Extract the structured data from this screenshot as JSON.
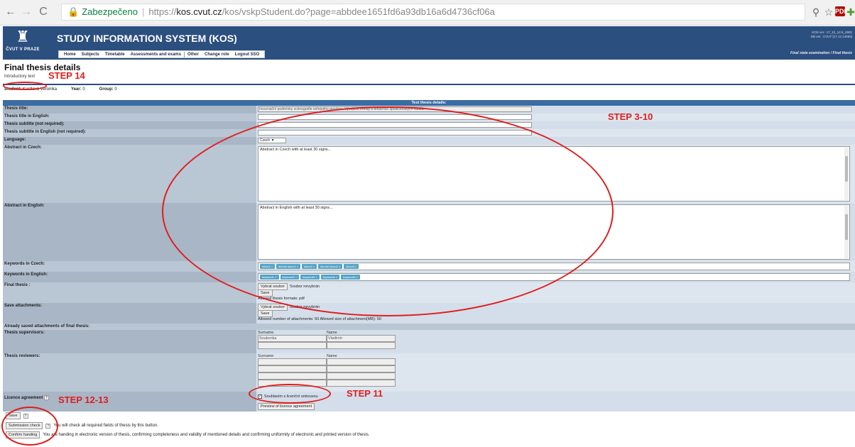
{
  "browser": {
    "secure_label": "Zabezpečeno",
    "url_protocol": "https://",
    "url_host": "kos.cvut.cz",
    "url_path": "/kos/vskpStudent.do?page=abbdee1651fd6a93db16a6d4736cf06a",
    "pdf_icon": "PDF"
  },
  "header": {
    "logo_text": "ČVUT V PRAZE",
    "app_title": "STUDY INFORMATION SYSTEM (KOS)",
    "menu": [
      "Home",
      "Subjects",
      "Timetable",
      "Assessments and exams",
      "Other",
      "Change role",
      "Logout SSO"
    ],
    "version_line1": "KOS ver.: 17_12_12.5_2602",
    "version_line2": "DB ver.: CVUT [17.12.14555]",
    "breadcrumb": "Final state examination / Final thesis"
  },
  "page": {
    "title": "Final thesis details",
    "intro": "Introductory text"
  },
  "student": {
    "label": "Student:",
    "name": "Kastlová Veronika",
    "year_label": "Year:",
    "year": "0",
    "group_label": "Group:",
    "group": "0"
  },
  "form": {
    "header": "Test thesis details:",
    "thesis_title_label": "Thesis title:",
    "thesis_title_value": "Inscenační podmínky scénografie veřejného prostoru. Vývojové trendy a tendence společenských rituálů.",
    "title_en_label": "Thesis title in English:",
    "subtitle_label": "Thesis subtitle (not required):",
    "subtitle_en_label": "Thesis subtitle in English (not required):",
    "language_label": "Language:",
    "language_value": "Czech",
    "abstract_cz_label": "Abstract in Czech:",
    "abstract_cz_placeholder": "Abstract in Czech with at least 30 signs...",
    "abstract_en_label": "Abstract in English:",
    "abstract_en_placeholder": "Abstract in English with at least 30 signs...",
    "keywords_cz_label": "Keywords in Czech:",
    "keywords_cz": [
      "slovo1 ×",
      "dlouhé slovo1 ×",
      "slovo2 ×",
      "dlouhé slovo2 ×",
      "slovo3 ×"
    ],
    "keywords_en_label": "Keywords in English:",
    "keywords_en": [
      "keyword1 ×",
      "keyword2 ×",
      "keyword3 ×",
      "keyword4 ×",
      "keyword5 ×"
    ],
    "final_thesis_label": "Final thesis :",
    "choose_file": "Vybrat soubor",
    "no_file": "Soubor nevybrán",
    "save": "Save",
    "allowed_formats": "Allowed thesis formats: pdf",
    "attachments_label": "Save attachments:",
    "attachments_note": "Allowed number of attachments: 50     Allowed size of attachment(MB): 50",
    "saved_attachments_label": "Already saved attachments of final thesis:",
    "supervisors_label": "Thesis supervisors:",
    "surname_head": "Surname",
    "name_head": "Name",
    "supervisor_surname": "Soukenka",
    "supervisor_name": "Vladimír",
    "reviewers_label": "Thesis reviewers:",
    "licence_label": "Licence agreement",
    "licence_agree": "Souhlasím s licenční smlouvou",
    "licence_preview": "Preview of licence agreement"
  },
  "bottom": {
    "save": "Save",
    "submission_check": "Submission check",
    "submission_note": "You will check all required fields of thesis by this button.",
    "confirm_handing": "Confirm handing",
    "confirm_note": "You are handing in electronic version of thesis, confirming completeness and validity of mentioned details and confirming uniformity of electronic and printed version of thesis."
  },
  "annotations": {
    "step14": "STEP 14",
    "step3_10": "STEP 3-10",
    "step11": "STEP 11",
    "step12_13": "STEP 12-13",
    "color": "#e11d1d"
  }
}
